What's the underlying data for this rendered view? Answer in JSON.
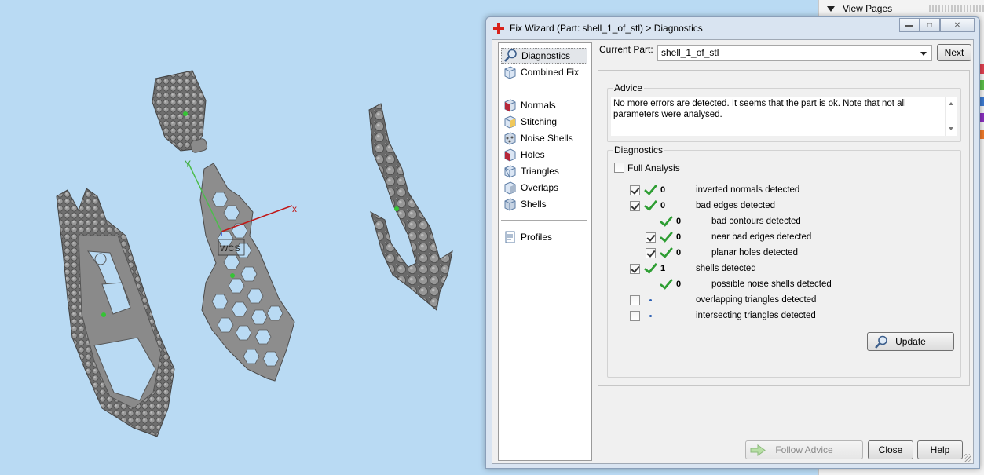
{
  "viewport": {
    "triad_label": "WCS",
    "axis_x_label": "x",
    "axis_y_label": "Y"
  },
  "dock": {
    "title": "View Pages",
    "swatch_colors": [
      "#e04050",
      "#5cbf4a",
      "#3d7ad0",
      "#8a2fbf",
      "#f07a2a"
    ]
  },
  "dialog": {
    "title": "Fix Wizard (Part: shell_1_of_stl) > Diagnostics",
    "nav": {
      "items": [
        {
          "label": "Diagnostics",
          "icon": "magnifier-icon",
          "selected": true
        },
        {
          "label": "Combined Fix",
          "icon": "cube-icon"
        },
        {
          "label": "Normals",
          "icon": "normals-cube-icon"
        },
        {
          "label": "Stitching",
          "icon": "stitching-cube-icon"
        },
        {
          "label": "Noise Shells",
          "icon": "noise-shells-icon"
        },
        {
          "label": "Holes",
          "icon": "holes-cube-icon"
        },
        {
          "label": "Triangles",
          "icon": "triangles-cube-icon"
        },
        {
          "label": "Overlaps",
          "icon": "overlaps-cube-icon"
        },
        {
          "label": "Shells",
          "icon": "shells-cube-icon"
        },
        {
          "label": "Profiles",
          "icon": "document-icon"
        }
      ]
    },
    "current_part": {
      "label": "Current Part:",
      "value": "shell_1_of_stl"
    },
    "next_label": "Next",
    "advice": {
      "title": "Advice",
      "text": "No more errors are detected. It seems that the part is ok. Note that not all parameters were analysed."
    },
    "diagnostics": {
      "title": "Diagnostics",
      "full_analysis_label": "Full Analysis",
      "rows": [
        {
          "checked": true,
          "status": "ok",
          "count": "0",
          "label": "inverted normals detected",
          "indent": 0,
          "has_checkbox": true
        },
        {
          "checked": true,
          "status": "ok",
          "count": "0",
          "label": "bad edges detected",
          "indent": 0,
          "has_checkbox": true
        },
        {
          "checked": false,
          "status": "ok",
          "count": "0",
          "label": "bad contours detected",
          "indent": 1,
          "has_checkbox": false
        },
        {
          "checked": true,
          "status": "ok",
          "count": "0",
          "label": "near bad edges detected",
          "indent": 1,
          "has_checkbox": true
        },
        {
          "checked": true,
          "status": "ok",
          "count": "0",
          "label": "planar holes detected",
          "indent": 1,
          "has_checkbox": true
        },
        {
          "checked": true,
          "status": "ok",
          "count": "1",
          "label": "shells detected",
          "indent": 0,
          "has_checkbox": true
        },
        {
          "checked": false,
          "status": "ok",
          "count": "0",
          "label": "possible noise shells detected",
          "indent": 1,
          "has_checkbox": false
        },
        {
          "checked": false,
          "status": "none",
          "count": "",
          "label": "overlapping triangles detected",
          "indent": 0,
          "has_checkbox": true
        },
        {
          "checked": false,
          "status": "none",
          "count": "",
          "label": "intersecting triangles detected",
          "indent": 0,
          "has_checkbox": true
        }
      ],
      "update_label": "Update"
    },
    "buttons": {
      "follow_advice": "Follow Advice",
      "close": "Close",
      "help": "Help"
    }
  }
}
